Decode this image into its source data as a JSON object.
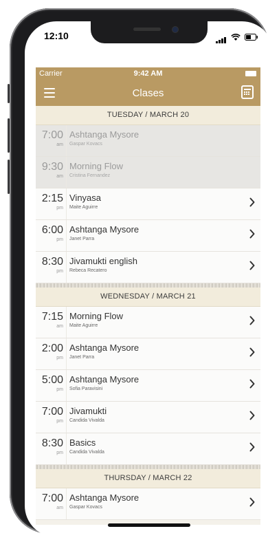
{
  "device": {
    "time": "12:10"
  },
  "status": {
    "carrier": "Carrier",
    "clock": "9:42 AM"
  },
  "nav": {
    "title": "Clases"
  },
  "sections": [
    {
      "header": "TUESDAY / MARCH 20",
      "rows": [
        {
          "time": "7:00",
          "ampm": "am",
          "title": "Ashtanga Mysore",
          "teacher": "Gaspar Kovacs",
          "past": true
        },
        {
          "time": "9:30",
          "ampm": "am",
          "title": "Morning Flow",
          "teacher": "Cristina Fernandez",
          "past": true
        },
        {
          "time": "2:15",
          "ampm": "pm",
          "title": "Vinyasa",
          "teacher": "Maite Aguirre",
          "past": false
        },
        {
          "time": "6:00",
          "ampm": "pm",
          "title": "Ashtanga Mysore",
          "teacher": "Janet Parra",
          "past": false
        },
        {
          "time": "8:30",
          "ampm": "pm",
          "title": "Jivamukti english",
          "teacher": "Rebeca Recatero",
          "past": false
        }
      ]
    },
    {
      "header": "WEDNESDAY / MARCH 21",
      "rows": [
        {
          "time": "7:15",
          "ampm": "am",
          "title": "Morning Flow",
          "teacher": "Maite Aguirre",
          "past": false
        },
        {
          "time": "2:00",
          "ampm": "pm",
          "title": "Ashtanga Mysore",
          "teacher": "Janet Parra",
          "past": false
        },
        {
          "time": "5:00",
          "ampm": "pm",
          "title": "Ashtanga Mysore",
          "teacher": "Sofia Paravisini",
          "past": false
        },
        {
          "time": "7:00",
          "ampm": "pm",
          "title": "Jivamukti",
          "teacher": "Candida Vivalda",
          "past": false
        },
        {
          "time": "8:30",
          "ampm": "pm",
          "title": "Basics",
          "teacher": "Candida Vivalda",
          "past": false
        }
      ]
    },
    {
      "header": "THURSDAY / MARCH 22",
      "rows": [
        {
          "time": "7:00",
          "ampm": "am",
          "title": "Ashtanga Mysore",
          "teacher": "Gaspar Kovacs",
          "past": false
        }
      ]
    }
  ],
  "colors": {
    "accent": "#b99a63",
    "section_bg": "#f2ecdc"
  },
  "icons": [
    "menu-icon",
    "calendar-icon",
    "chevron-right-icon",
    "wifi-icon",
    "battery-icon",
    "signal-icon"
  ]
}
